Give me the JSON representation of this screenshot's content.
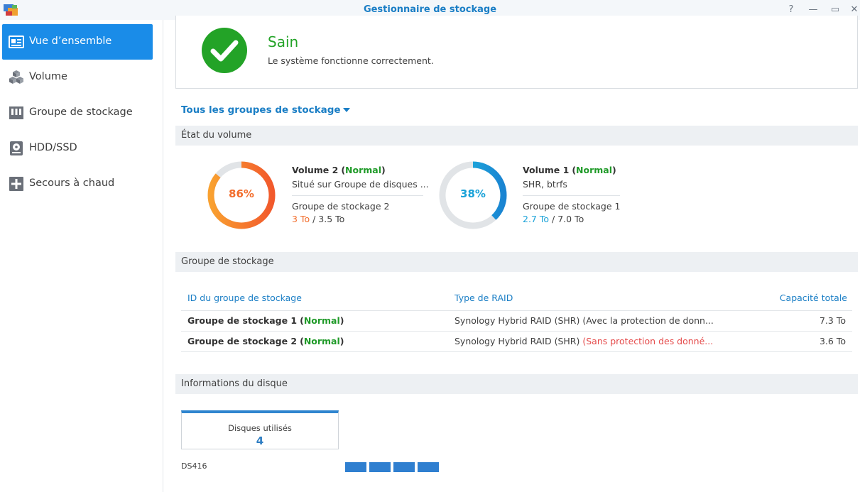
{
  "window": {
    "title": "Gestionnaire de stockage",
    "help_glyph": "?",
    "minimize_glyph": "—",
    "maximize_glyph": "▭",
    "close_glyph": "✕"
  },
  "sidebar": {
    "items": [
      {
        "label": "Vue d’ensemble",
        "icon": "overview-icon",
        "active": true
      },
      {
        "label": "Volume",
        "icon": "cubes-icon",
        "active": false
      },
      {
        "label": "Groupe de stockage",
        "icon": "storage-pool-icon",
        "active": false
      },
      {
        "label": "HDD/SSD",
        "icon": "hdd-icon",
        "active": false
      },
      {
        "label": "Secours à chaud",
        "icon": "hot-spare-icon",
        "active": false
      }
    ]
  },
  "health": {
    "title": "Sain",
    "description": "Le système fonctionne correctement.",
    "icon": "check-circle-icon",
    "color": "#23a327"
  },
  "pool_filter": {
    "label": "Tous les groupes de stockage"
  },
  "volume_section": {
    "title": "État du volume",
    "volumes": [
      {
        "name": "Volume 2",
        "status": "Normal",
        "percent": 86,
        "percent_label": "86%",
        "location": "Situé sur Groupe de disques ...",
        "pool": "Groupe de stockage 2",
        "used": "3 To",
        "sep": "/",
        "total": "3.5 To",
        "color": "#f26d2c"
      },
      {
        "name": "Volume 1",
        "status": "Normal",
        "percent": 38,
        "percent_label": "38%",
        "location": "SHR, btrfs",
        "pool": "Groupe de stockage 1",
        "used": "2.7 To",
        "sep": "/",
        "total": "7.0 To",
        "color": "#1aa2d8"
      }
    ]
  },
  "pool_section": {
    "title": "Groupe de stockage",
    "columns": [
      "ID du groupe de stockage",
      "Type de RAID",
      "Capacité totale"
    ],
    "rows": [
      {
        "name": "Groupe de stockage 1",
        "status": "Normal",
        "raid": "Synology Hybrid RAID (SHR)",
        "protection": "(Avec la protection de donn...",
        "protection_warning": false,
        "capacity": "7.3 To"
      },
      {
        "name": "Groupe de stockage 2",
        "status": "Normal",
        "raid": "Synology Hybrid RAID (SHR)",
        "protection": "(Sans protection des donné...",
        "protection_warning": true,
        "capacity": "3.6 To"
      }
    ]
  },
  "disk_section": {
    "title": "Informations du disque",
    "used_label": "Disques utilisés",
    "used_count": "4",
    "model": "DS416",
    "slots": 4
  }
}
